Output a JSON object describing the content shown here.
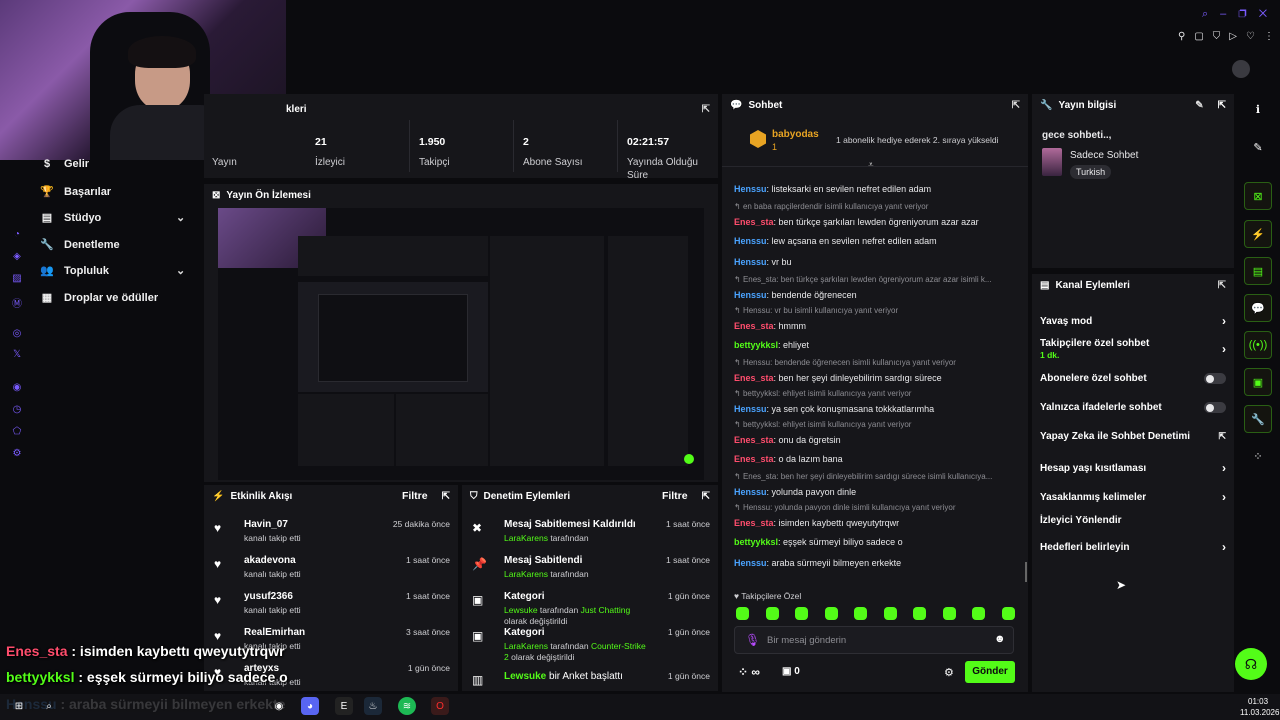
{
  "stats": {
    "title": "Yayın İstatistikleri",
    "title_visible": "kleri",
    "items": [
      {
        "value": "",
        "label": "Yayın"
      },
      {
        "value": "21",
        "label": "İzleyici"
      },
      {
        "value": "1.950",
        "label": "Takipçi"
      },
      {
        "value": "2",
        "label": "Abone Sayısı"
      },
      {
        "value": "02:21:57",
        "label": "Yayında Olduğu Süre"
      }
    ]
  },
  "sidebar": {
    "items": [
      {
        "label": "Gelir"
      },
      {
        "label": "Başarılar"
      },
      {
        "label": "Stüdyo"
      },
      {
        "label": "Denetleme"
      },
      {
        "label": "Topluluk"
      },
      {
        "label": "Droplar ve ödüller"
      }
    ]
  },
  "preview": {
    "title": "Yayın Ön İzlemesi"
  },
  "activity": {
    "title": "Etkinlik Akışı",
    "filter": "Filtre",
    "items": [
      {
        "name": "Havin_07",
        "sub": "kanalı takip etti",
        "time": "25 dakika önce"
      },
      {
        "name": "akadevona",
        "sub": "kanalı takip etti",
        "time": "1 saat önce"
      },
      {
        "name": "yusuf2366",
        "sub": "kanalı takip etti",
        "time": "1 saat önce"
      },
      {
        "name": "RealEmirhan",
        "sub": "kanalı takip etti",
        "time": "3 saat önce"
      },
      {
        "name": "arteyxs",
        "sub": "kanalı takip etti",
        "time": "1 gün önce"
      }
    ]
  },
  "mod": {
    "title": "Denetim Eylemleri",
    "filter": "Filtre",
    "items": [
      {
        "title": "Mesaj Sabitlemesi Kaldırıldı",
        "user": "LaraKarens",
        "rest": " tarafından",
        "extra": "",
        "time": "1 saat önce"
      },
      {
        "title": "Mesaj Sabitlendi",
        "user": "LaraKarens",
        "rest": " tarafından",
        "extra": "",
        "time": "1 saat önce"
      },
      {
        "title": "Kategori",
        "user": "Lewsuke",
        "rest": " tarafından ",
        "hl": "Just Chatting",
        "extra": " olarak değiştirildi",
        "time": "1 gün önce"
      },
      {
        "title": "Kategori",
        "user": "LaraKarens",
        "rest": " tarafından ",
        "hl": "Counter-Strike 2",
        "extra": " olarak değiştirildi",
        "time": "1 gün önce"
      },
      {
        "title": "",
        "user": "Lewsuke",
        "rest": " bir Anket başlattı",
        "extra": "",
        "time": "1 gün önce"
      }
    ]
  },
  "chat": {
    "title": "Sohbet",
    "pinned_user": "babyodas",
    "pinned_count": "1",
    "pinned_msg": "1 abonelik hediye ederek 2. sıraya yükseldi",
    "messages": [
      {
        "reply": "",
        "user": "Henssu",
        "color": "#4aa3ff",
        "text": "listeksarki en sevilen nefret edilen adam"
      },
      {
        "reply": "en baba rapçilerdendir isimli kullanıcıya yanıt veriyor",
        "user": "Enes_sta",
        "color": "#ff4d6d",
        "text": "ben türkçe şarkıları lewden ögreniyorum azar azar"
      },
      {
        "reply": "",
        "user": "Henssu",
        "color": "#4aa3ff",
        "text": "lew açsana en sevilen nefret edilen adam"
      },
      {
        "reply": "",
        "user": "Henssu",
        "color": "#4aa3ff",
        "text": "vr bu"
      },
      {
        "reply": "Enes_sta: ben türkçe şarkıları lewden ögreniyorum azar azar isimli k...",
        "user": "Henssu",
        "color": "#4aa3ff",
        "text": "bendende öğrenecen"
      },
      {
        "reply": "Henssu: vr bu isimli kullanıcıya yanıt veriyor",
        "user": "Enes_sta",
        "color": "#ff4d6d",
        "text": "hmmm"
      },
      {
        "reply": "",
        "user": "bettyykksl",
        "color": "#53fc18",
        "text": "ehliyet"
      },
      {
        "reply": "Henssu: bendende öğrenecen isimli kullanıcıya yanıt veriyor",
        "user": "Enes_sta",
        "color": "#ff4d6d",
        "text": "ben her şeyi dinleyebilirim sardıgı sürece"
      },
      {
        "reply": "bettyykksl: ehliyet isimli kullanıcıya yanıt veriyor",
        "user": "Henssu",
        "color": "#4aa3ff",
        "text": "ya sen çok konuşmasana tokkkatlarımha"
      },
      {
        "reply": "bettyykksl: ehliyet isimli kullanıcıya yanıt veriyor",
        "user": "Enes_sta",
        "color": "#ff4d6d",
        "text": "onu da ögretsin"
      },
      {
        "reply": "",
        "user": "Enes_sta",
        "color": "#ff4d6d",
        "text": "o da lazım bana"
      },
      {
        "reply": "Enes_sta: ben her şeyi dinleyebilirim sardıgı sürece isimli kullanıcıya...",
        "user": "Henssu",
        "color": "#4aa3ff",
        "text": "yolunda pavyon dinle"
      },
      {
        "reply": "Henssu: yolunda pavyon dinle isimli kullanıcıya yanıt veriyor",
        "user": "Enes_sta",
        "color": "#ff4d6d",
        "text": "isimden kaybettı qweyutytrqwr"
      },
      {
        "reply": "",
        "user": "bettyykksl",
        "color": "#53fc18",
        "text": "eşşek sürmeyi biliyo sadece o"
      },
      {
        "reply": "",
        "user": "Henssu",
        "color": "#4aa3ff",
        "text": "araba sürmeyii bilmeyen erkekte"
      }
    ],
    "followers_only": "Takipçilere Özel",
    "placeholder": "Bir mesaj gönderin",
    "points": "∞",
    "gifts": "0",
    "send": "Gönder"
  },
  "info": {
    "title": "Yayın bilgisi",
    "stream_title": "gece sohbeti..,",
    "category": "Sadece Sohbet",
    "tag": "Turkish"
  },
  "channel": {
    "title": "Kanal Eylemleri",
    "items": [
      {
        "label": "Yavaş mod",
        "sub": "",
        "kind": "chevron"
      },
      {
        "label": "Takipçilere özel sohbet",
        "sub": "1 dk.",
        "kind": "chevron"
      },
      {
        "label": "Abonelere özel sohbet",
        "sub": "",
        "kind": "toggle"
      },
      {
        "label": "Yalnızca ifadelerle sohbet",
        "sub": "",
        "kind": "toggle"
      },
      {
        "label": "Yapay Zeka ile Sohbet Denetimi",
        "sub": "",
        "kind": "external"
      },
      {
        "label": "Hesap yaşı kısıtlaması",
        "sub": "",
        "kind": "chevron"
      },
      {
        "label": "Yasaklanmış kelimeler",
        "sub": "",
        "kind": "chevron"
      },
      {
        "label": "İzleyici Yönlendir",
        "sub": "",
        "kind": "none"
      },
      {
        "label": "Hedefleri belirleyin",
        "sub": "",
        "kind": "chevron"
      }
    ]
  },
  "overlay": {
    "lines": [
      {
        "user": "Enes_sta",
        "color": "#ff4d6d",
        "text": " : isimden kaybettı qweyutytrqwr"
      },
      {
        "user": "bettyykksl",
        "color": "#53fc18",
        "text": " : eşşek sürmeyi biliyo sadece o"
      },
      {
        "user": "Henssu",
        "color": "#4aa3ff",
        "text": " : araba sürmeyii bilmeyen erkekte"
      }
    ]
  },
  "taskbar": {
    "time": "01:03",
    "date": "11.03.2026"
  },
  "colors": {
    "accent": "#53fc18",
    "panel": "#16161a",
    "bg": "#0b0b0e"
  }
}
